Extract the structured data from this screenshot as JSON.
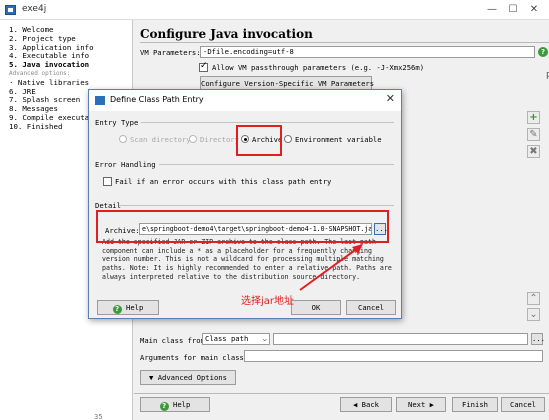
{
  "window": {
    "title": "exe4j",
    "minimize": "—",
    "maximize": "☐",
    "close": "✕"
  },
  "sidebar": {
    "steps": [
      {
        "label": "1. Welcome",
        "current": false,
        "sub": false
      },
      {
        "label": "2. Project type",
        "current": false,
        "sub": false
      },
      {
        "label": "3. Application info",
        "current": false,
        "sub": false
      },
      {
        "label": "4. Executable info",
        "current": false,
        "sub": false
      },
      {
        "label": "5. Java invocation",
        "current": true,
        "sub": false
      },
      {
        "label": "Advanced options:",
        "current": false,
        "sub": true
      },
      {
        "label": "· Native libraries",
        "current": false,
        "sub": false
      },
      {
        "label": "6. JRE",
        "current": false,
        "sub": false
      },
      {
        "label": "7. Splash screen",
        "current": false,
        "sub": false
      },
      {
        "label": "8. Messages",
        "current": false,
        "sub": false
      },
      {
        "label": "9. Compile executable",
        "current": false,
        "sub": false
      },
      {
        "label": "10. Finished",
        "current": false,
        "sub": false
      }
    ],
    "watermark": "exe4j"
  },
  "main": {
    "heading": "Configure Java invocation",
    "vm_label": "VM Parameters:",
    "vm_value": "-Dfile.encoding=utf-8",
    "allow_vm": "Allow VM passthrough parameters (e.g. -J-Xmx256m)",
    "version_button": "Configure Version-Specific VM Parameters",
    "main_class_from": "Main class from",
    "main_class_source": "Class path",
    "args_label": "Arguments for main class:",
    "advanced_button": "Advanced Options",
    "help": "Help",
    "back": "Back",
    "next": "Next",
    "finish": "Finish",
    "cancel": "Cancel",
    "browse": "...",
    "version_text": "35"
  },
  "dialog": {
    "title": "Define Class Path Entry",
    "close": "✕",
    "entry_type": "Entry Type",
    "scan_directory": "Scan directory",
    "directory": "Directory",
    "archive": "Archive",
    "env_var": "Environment variable",
    "error_handling": "Error Handling",
    "fail_if_error": "Fail if an error occurs with this class path entry",
    "detail": "Detail",
    "archive_label": "Archive:",
    "archive_value": "e\\springboot-demo4\\target\\springboot-demo4-1.0-SNAPSHOT.jar",
    "browse": "...",
    "description": "Add the specified JAR or ZIP archive to the class path. The last path component can include a * as a placeholder for a frequently changing version number. This is not a wildcard for processing multiple matching paths. Note: It is highly recommended to enter a relative path. Paths are always interpreted relative to the distribution source directory.",
    "help": "Help",
    "ok": "OK",
    "cancel": "Cancel"
  },
  "annotation": {
    "text": "选择jar地址",
    "color": "#e02020"
  }
}
